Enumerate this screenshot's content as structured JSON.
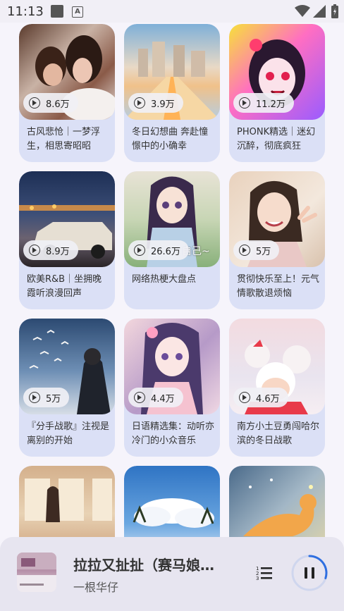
{
  "status": {
    "time": "11:13",
    "notif_icon": "A"
  },
  "grid": [
    {
      "plays": "8.6万",
      "title": "古风悲怆｜一梦浮生，相思寄昭昭"
    },
    {
      "plays": "3.9万",
      "title": "冬日幻想曲 奔赴憧憬中的小确幸"
    },
    {
      "plays": "11.2万",
      "title": "PHONK精选｜迷幻沉醉，彻底疯狂"
    },
    {
      "plays": "8.9万",
      "title": "欧美R&B｜坐拥晚霞听浪漫回声"
    },
    {
      "plays": "26.6万",
      "title": "网络热梗大盘点",
      "cover_text": "自己~"
    },
    {
      "plays": "5万",
      "title": "贯彻快乐至上！元气情歌散退烦恼"
    },
    {
      "plays": "5万",
      "title": "『分手战歌』注视是离别的开始"
    },
    {
      "plays": "4.4万",
      "title": "日语精选集：动听亦冷门的小众音乐"
    },
    {
      "plays": "4.6万",
      "title": "南方小土豆勇闯哈尔滨的冬日战歌"
    },
    {
      "plays": "",
      "title": ""
    },
    {
      "plays": "",
      "title": ""
    },
    {
      "plays": "",
      "title": ""
    }
  ],
  "player": {
    "title": "拉拉又扯扯（赛马娘…",
    "artist": "一根华仔",
    "progress": 0.3
  }
}
